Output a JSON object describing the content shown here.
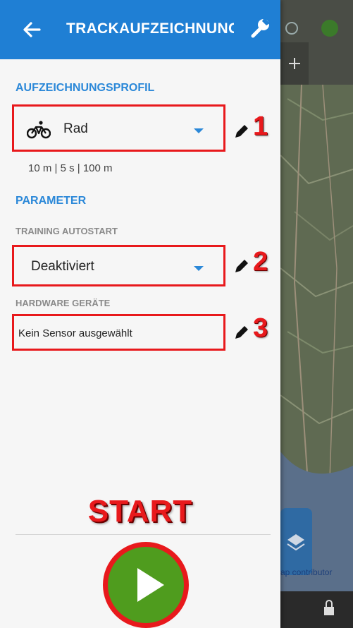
{
  "appbar": {
    "title": "TRACKAUFZEICHNUNG",
    "color": "#1f7fd4"
  },
  "profile": {
    "section_label": "AUFZEICHNUNGSPROFIL",
    "selected": "Rad",
    "icon": "bicycle-icon",
    "summary": "10 m | 5 s | 100 m",
    "annotation": "1"
  },
  "parameters": {
    "section_label": "PARAMETER",
    "training_autostart": {
      "label": "TRAINING AUTOSTART",
      "selected": "Deaktiviert",
      "annotation": "2"
    },
    "hardware": {
      "label": "HARDWARE GERÄTE",
      "value": "Kein Sensor ausgewählt",
      "annotation": "3"
    }
  },
  "start": {
    "label": "START"
  },
  "map": {
    "attribution": "ap contributor"
  },
  "colors": {
    "accent": "#2b88d8",
    "annotation_red": "#e8191c",
    "play_green": "#4f9c1e"
  }
}
